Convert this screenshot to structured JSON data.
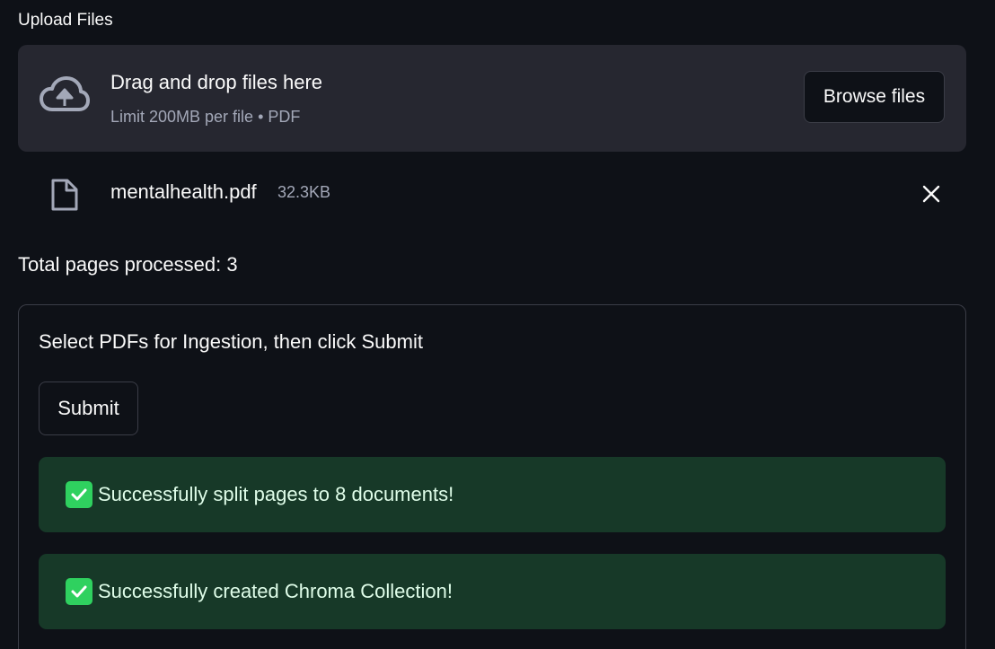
{
  "uploader": {
    "label": "Upload Files",
    "dropzone_title": "Drag and drop files here",
    "dropzone_subtitle": "Limit 200MB per file • PDF",
    "browse_label": "Browse files"
  },
  "file": {
    "name": "mentalhealth.pdf",
    "size": "32.3KB"
  },
  "status": {
    "pages_processed": "Total pages processed: 3"
  },
  "form": {
    "title": "Select PDFs for Ingestion, then click Submit",
    "submit_label": "Submit",
    "alerts": [
      {
        "text": "Successfully split pages to 8 documents!"
      },
      {
        "text": "Successfully created Chroma Collection!"
      }
    ]
  },
  "colors": {
    "background": "#0e1117",
    "dropzone": "#262730",
    "success_bg": "#173928",
    "success_icon": "#2fd15f"
  },
  "icons": [
    "cloud-upload-icon",
    "file-icon",
    "close-icon",
    "check-icon"
  ]
}
